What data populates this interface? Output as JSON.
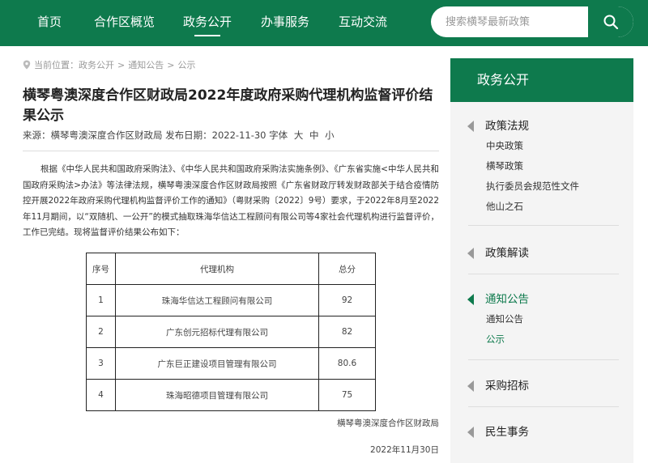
{
  "nav": {
    "items": [
      {
        "label": "首页"
      },
      {
        "label": "合作区概览"
      },
      {
        "label": "政务公开"
      },
      {
        "label": "办事服务"
      },
      {
        "label": "互动交流"
      }
    ],
    "active_index": 2
  },
  "search": {
    "placeholder": "搜索横琴最新政策",
    "icon": "search-icon"
  },
  "breadcrumb": {
    "prefix": "当前位置：",
    "items": [
      "政务公开",
      "通知公告",
      "公示"
    ],
    "separator": ">"
  },
  "article": {
    "title": "横琴粤澳深度合作区财政局2022年度政府采购代理机构监督评价结果公示",
    "source_label": "来源：",
    "source": "横琴粤澳深度合作区财政局",
    "date_label": "发布日期：",
    "date": "2022-11-30",
    "font_label": "字体",
    "font_sizes": [
      "大",
      "中",
      "小"
    ],
    "body": "根据《中华人民共和国政府采购法》、《中华人民共和国政府采购法实施条例》、《广东省实施<中华人民共和国政府采购法>办法》等法律法规，横琴粤澳深度合作区财政局按照《广东省财政厅转发财政部关于结合疫情防控开展2022年政府采购代理机构监督评价工作的通知》（粤财采购〔2022〕9号）要求，于2022年8月至2022年11月期间，以“双随机、一公开”的模式抽取珠海华信达工程顾问有限公司等4家社会代理机构进行监督评价，工作已完结。现将监督评价结果公布如下：",
    "table": {
      "headers": [
        "序号",
        "代理机构",
        "总分"
      ],
      "rows": [
        [
          "1",
          "珠海华信达工程顾问有限公司",
          "92"
        ],
        [
          "2",
          "广东创元招标代理有限公司",
          "82"
        ],
        [
          "3",
          "广东巨正建设项目管理有限公司",
          "80.6"
        ],
        [
          "4",
          "珠海昭德项目管理有限公司",
          "75"
        ]
      ]
    },
    "signature": "横琴粤澳深度合作区财政局",
    "sign_date": "2022年11月30日"
  },
  "sidebar": {
    "title": "政务公开",
    "groups": [
      {
        "title": "政策法规",
        "items": [
          "中央政策",
          "横琴政策",
          "执行委员会规范性文件",
          "他山之石"
        ]
      },
      {
        "title": "政策解读",
        "items": []
      },
      {
        "title": "通知公告",
        "items": [
          "通知公告",
          "公示"
        ]
      },
      {
        "title": "采购招标",
        "items": []
      },
      {
        "title": "民生事务",
        "items": []
      }
    ],
    "active_group": "通知公告",
    "active_item": "公示"
  },
  "colors": {
    "brand": "#0e7a4d"
  }
}
